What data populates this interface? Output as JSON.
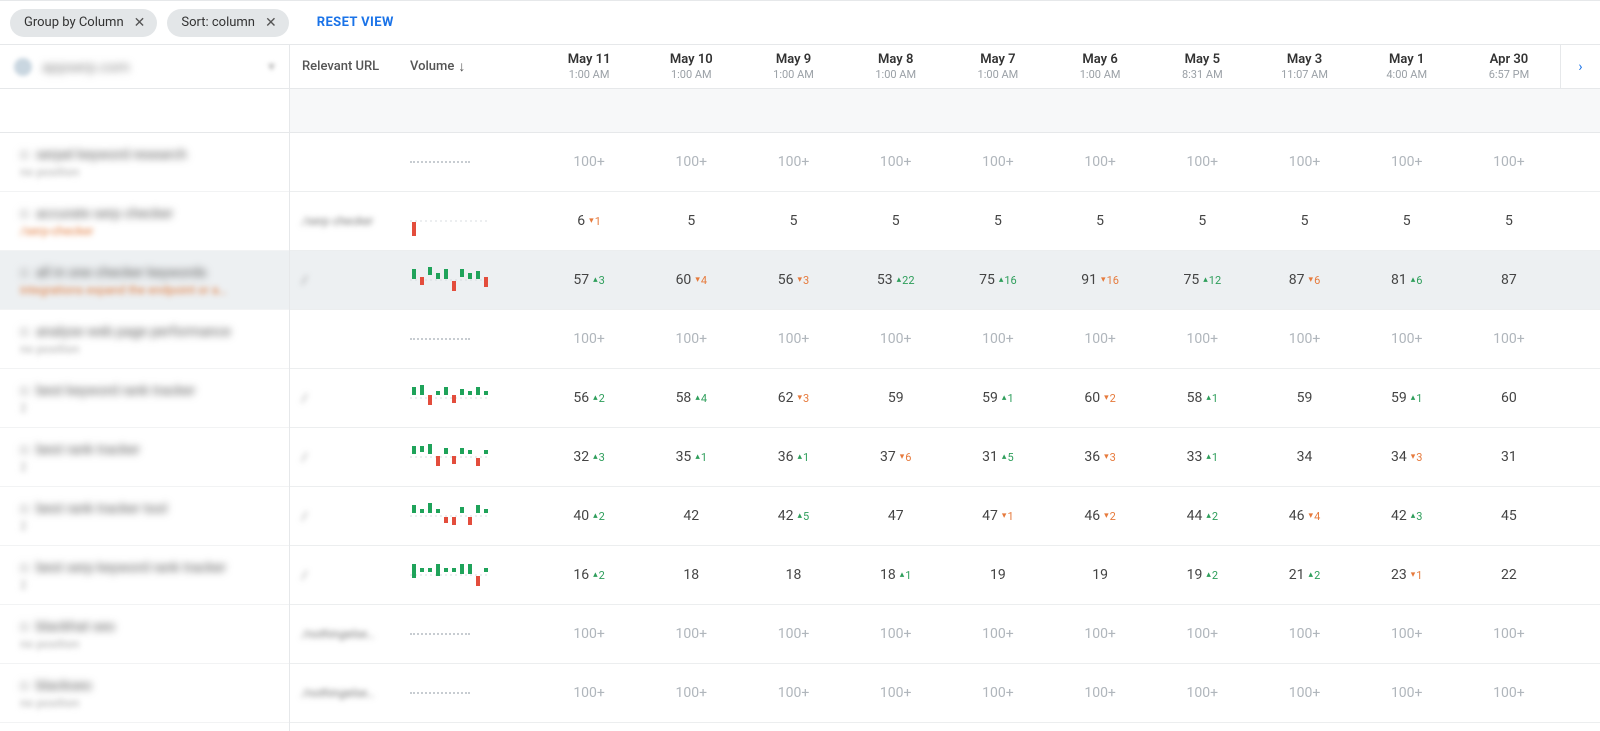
{
  "topbar": {
    "chip_group": "Group by Column",
    "chip_sort": "Sort: column",
    "reset": "RESET VIEW"
  },
  "sidebar": {
    "domain": "appserp.com",
    "items": [
      {
        "line1": "serpel keyword research",
        "line2": "no position",
        "warn": false
      },
      {
        "line1": "accurate serp checker",
        "line2": "/serp-checker",
        "warn": true
      },
      {
        "line1": "all in one checker keywords",
        "line2": "integrations expand the endpoint or a…",
        "warn": true,
        "selected": true
      },
      {
        "line1": "analyse web page performance",
        "line2": "no position",
        "warn": false
      },
      {
        "line1": "best keyword rank tracker",
        "line2": "2",
        "warn": false
      },
      {
        "line1": "best rank tracker",
        "line2": "2",
        "warn": false
      },
      {
        "line1": "best rank tracker tool",
        "line2": "2",
        "warn": false
      },
      {
        "line1": "best serp keyword rank tracker",
        "line2": "2",
        "warn": false
      },
      {
        "line1": "blackhat seo",
        "line2": "no position",
        "warn": false
      },
      {
        "line1": "blackseo",
        "line2": "no position",
        "warn": false
      }
    ]
  },
  "columns": {
    "url": "Relevant URL",
    "volume": "Volume",
    "dates": [
      {
        "d": "May 11",
        "t": "1:00 AM"
      },
      {
        "d": "May 10",
        "t": "1:00 AM"
      },
      {
        "d": "May 9",
        "t": "1:00 AM"
      },
      {
        "d": "May 8",
        "t": "1:00 AM"
      },
      {
        "d": "May 7",
        "t": "1:00 AM"
      },
      {
        "d": "May 6",
        "t": "1:00 AM"
      },
      {
        "d": "May 5",
        "t": "8:31 AM"
      },
      {
        "d": "May 3",
        "t": "11:07 AM"
      },
      {
        "d": "May 1",
        "t": "4:00 AM"
      },
      {
        "d": "Apr 30",
        "t": "6:57 PM"
      }
    ]
  },
  "rows": [
    {
      "url": "",
      "vol": "dash",
      "cells": [
        {
          "v": "100+",
          "muted": true
        },
        {
          "v": "100+",
          "muted": true
        },
        {
          "v": "100+",
          "muted": true
        },
        {
          "v": "100+",
          "muted": true
        },
        {
          "v": "100+",
          "muted": true
        },
        {
          "v": "100+",
          "muted": true
        },
        {
          "v": "100+",
          "muted": true
        },
        {
          "v": "100+",
          "muted": true
        },
        {
          "v": "100+",
          "muted": true
        },
        {
          "v": "100+",
          "muted": true
        }
      ]
    },
    {
      "url": "/serp checker",
      "vol": "sparkA",
      "cells": [
        {
          "v": "6",
          "d": "1",
          "dir": "down"
        },
        {
          "v": "5"
        },
        {
          "v": "5"
        },
        {
          "v": "5"
        },
        {
          "v": "5"
        },
        {
          "v": "5"
        },
        {
          "v": "5"
        },
        {
          "v": "5"
        },
        {
          "v": "5"
        },
        {
          "v": "5"
        }
      ]
    },
    {
      "url": "/",
      "vol": "sparkB",
      "selected": true,
      "cells": [
        {
          "v": "57",
          "d": "3",
          "dir": "up"
        },
        {
          "v": "60",
          "d": "4",
          "dir": "down"
        },
        {
          "v": "56",
          "d": "3",
          "dir": "down"
        },
        {
          "v": "53",
          "d": "22",
          "dir": "up"
        },
        {
          "v": "75",
          "d": "16",
          "dir": "up"
        },
        {
          "v": "91",
          "d": "16",
          "dir": "down"
        },
        {
          "v": "75",
          "d": "12",
          "dir": "up"
        },
        {
          "v": "87",
          "d": "6",
          "dir": "down"
        },
        {
          "v": "81",
          "d": "6",
          "dir": "up"
        },
        {
          "v": "87"
        }
      ]
    },
    {
      "url": "",
      "vol": "dash",
      "cells": [
        {
          "v": "100+",
          "muted": true
        },
        {
          "v": "100+",
          "muted": true
        },
        {
          "v": "100+",
          "muted": true
        },
        {
          "v": "100+",
          "muted": true
        },
        {
          "v": "100+",
          "muted": true
        },
        {
          "v": "100+",
          "muted": true
        },
        {
          "v": "100+",
          "muted": true
        },
        {
          "v": "100+",
          "muted": true
        },
        {
          "v": "100+",
          "muted": true
        },
        {
          "v": "100+",
          "muted": true
        }
      ]
    },
    {
      "url": "/",
      "vol": "sparkC",
      "cells": [
        {
          "v": "56",
          "d": "2",
          "dir": "up"
        },
        {
          "v": "58",
          "d": "4",
          "dir": "up"
        },
        {
          "v": "62",
          "d": "3",
          "dir": "down"
        },
        {
          "v": "59"
        },
        {
          "v": "59",
          "d": "1",
          "dir": "up"
        },
        {
          "v": "60",
          "d": "2",
          "dir": "down"
        },
        {
          "v": "58",
          "d": "1",
          "dir": "up"
        },
        {
          "v": "59"
        },
        {
          "v": "59",
          "d": "1",
          "dir": "up"
        },
        {
          "v": "60"
        }
      ]
    },
    {
      "url": "/",
      "vol": "sparkD",
      "cells": [
        {
          "v": "32",
          "d": "3",
          "dir": "up"
        },
        {
          "v": "35",
          "d": "1",
          "dir": "up"
        },
        {
          "v": "36",
          "d": "1",
          "dir": "up"
        },
        {
          "v": "37",
          "d": "6",
          "dir": "down"
        },
        {
          "v": "31",
          "d": "5",
          "dir": "up"
        },
        {
          "v": "36",
          "d": "3",
          "dir": "down"
        },
        {
          "v": "33",
          "d": "1",
          "dir": "up"
        },
        {
          "v": "34"
        },
        {
          "v": "34",
          "d": "3",
          "dir": "down"
        },
        {
          "v": "31"
        }
      ]
    },
    {
      "url": "/",
      "vol": "sparkE",
      "cells": [
        {
          "v": "40",
          "d": "2",
          "dir": "up"
        },
        {
          "v": "42"
        },
        {
          "v": "42",
          "d": "5",
          "dir": "up"
        },
        {
          "v": "47"
        },
        {
          "v": "47",
          "d": "1",
          "dir": "down"
        },
        {
          "v": "46",
          "d": "2",
          "dir": "down"
        },
        {
          "v": "44",
          "d": "2",
          "dir": "up"
        },
        {
          "v": "46",
          "d": "4",
          "dir": "down"
        },
        {
          "v": "42",
          "d": "3",
          "dir": "up"
        },
        {
          "v": "45"
        }
      ]
    },
    {
      "url": "/",
      "vol": "sparkF",
      "cells": [
        {
          "v": "16",
          "d": "2",
          "dir": "up"
        },
        {
          "v": "18"
        },
        {
          "v": "18"
        },
        {
          "v": "18",
          "d": "1",
          "dir": "up"
        },
        {
          "v": "19"
        },
        {
          "v": "19"
        },
        {
          "v": "19",
          "d": "2",
          "dir": "up"
        },
        {
          "v": "21",
          "d": "2",
          "dir": "up"
        },
        {
          "v": "23",
          "d": "1",
          "dir": "down"
        },
        {
          "v": "22"
        }
      ]
    },
    {
      "url": "/nothingelse…",
      "vol": "dash",
      "cells": [
        {
          "v": "100+",
          "muted": true
        },
        {
          "v": "100+",
          "muted": true
        },
        {
          "v": "100+",
          "muted": true
        },
        {
          "v": "100+",
          "muted": true
        },
        {
          "v": "100+",
          "muted": true
        },
        {
          "v": "100+",
          "muted": true
        },
        {
          "v": "100+",
          "muted": true
        },
        {
          "v": "100+",
          "muted": true
        },
        {
          "v": "100+",
          "muted": true
        },
        {
          "v": "100+",
          "muted": true
        }
      ]
    },
    {
      "url": "/nothingelse…",
      "vol": "dash",
      "cells": [
        {
          "v": "100+",
          "muted": true
        },
        {
          "v": "100+",
          "muted": true
        },
        {
          "v": "100+",
          "muted": true
        },
        {
          "v": "100+",
          "muted": true
        },
        {
          "v": "100+",
          "muted": true
        },
        {
          "v": "100+",
          "muted": true
        },
        {
          "v": "100+",
          "muted": true
        },
        {
          "v": "100+",
          "muted": true
        },
        {
          "v": "100+",
          "muted": true
        },
        {
          "v": "100+",
          "muted": true
        }
      ]
    }
  ],
  "sparks": {
    "sparkA": [
      {
        "y": 18,
        "h": 14,
        "c": "r"
      }
    ],
    "sparkB": [
      {
        "y": 6,
        "h": 10,
        "c": "g"
      },
      {
        "y": 14,
        "h": 8,
        "c": "r"
      },
      {
        "y": 4,
        "h": 8,
        "c": "g"
      },
      {
        "y": 10,
        "h": 6,
        "c": "g"
      },
      {
        "y": 6,
        "h": 10,
        "c": "g"
      },
      {
        "y": 18,
        "h": 10,
        "c": "r"
      },
      {
        "y": 6,
        "h": 8,
        "c": "g"
      },
      {
        "y": 10,
        "h": 6,
        "c": "g"
      },
      {
        "y": 8,
        "h": 8,
        "c": "g"
      },
      {
        "y": 14,
        "h": 10,
        "c": "r"
      }
    ],
    "sparkC": [
      {
        "y": 6,
        "h": 8,
        "c": "g"
      },
      {
        "y": 4,
        "h": 10,
        "c": "g"
      },
      {
        "y": 14,
        "h": 10,
        "c": "r"
      },
      {
        "y": 10,
        "h": 4,
        "c": "g"
      },
      {
        "y": 6,
        "h": 8,
        "c": "g"
      },
      {
        "y": 14,
        "h": 8,
        "c": "r"
      },
      {
        "y": 8,
        "h": 6,
        "c": "g"
      },
      {
        "y": 10,
        "h": 4,
        "c": "g"
      },
      {
        "y": 6,
        "h": 8,
        "c": "g"
      },
      {
        "y": 10,
        "h": 4,
        "c": "g"
      }
    ],
    "sparkD": [
      {
        "y": 6,
        "h": 8,
        "c": "g"
      },
      {
        "y": 6,
        "h": 6,
        "c": "g"
      },
      {
        "y": 4,
        "h": 10,
        "c": "g"
      },
      {
        "y": 16,
        "h": 10,
        "c": "r"
      },
      {
        "y": 8,
        "h": 6,
        "c": "g"
      },
      {
        "y": 16,
        "h": 8,
        "c": "r"
      },
      {
        "y": 8,
        "h": 6,
        "c": "g"
      },
      {
        "y": 10,
        "h": 4,
        "c": "g"
      },
      {
        "y": 18,
        "h": 8,
        "c": "r"
      },
      {
        "y": 10,
        "h": 4,
        "c": "g"
      }
    ],
    "sparkE": [
      {
        "y": 6,
        "h": 8,
        "c": "g"
      },
      {
        "y": 10,
        "h": 4,
        "c": "g"
      },
      {
        "y": 4,
        "h": 10,
        "c": "g"
      },
      {
        "y": 10,
        "h": 4,
        "c": "g"
      },
      {
        "y": 18,
        "h": 6,
        "c": "r"
      },
      {
        "y": 18,
        "h": 8,
        "c": "r"
      },
      {
        "y": 8,
        "h": 6,
        "c": "g"
      },
      {
        "y": 18,
        "h": 8,
        "c": "r"
      },
      {
        "y": 6,
        "h": 8,
        "c": "g"
      },
      {
        "y": 10,
        "h": 4,
        "c": "g"
      }
    ],
    "sparkF": [
      {
        "y": 6,
        "h": 14,
        "c": "g"
      },
      {
        "y": 10,
        "h": 4,
        "c": "g"
      },
      {
        "y": 10,
        "h": 4,
        "c": "g"
      },
      {
        "y": 6,
        "h": 12,
        "c": "g"
      },
      {
        "y": 10,
        "h": 4,
        "c": "g"
      },
      {
        "y": 10,
        "h": 4,
        "c": "g"
      },
      {
        "y": 6,
        "h": 10,
        "c": "g"
      },
      {
        "y": 6,
        "h": 10,
        "c": "g"
      },
      {
        "y": 18,
        "h": 10,
        "c": "r"
      },
      {
        "y": 10,
        "h": 4,
        "c": "g"
      }
    ]
  }
}
